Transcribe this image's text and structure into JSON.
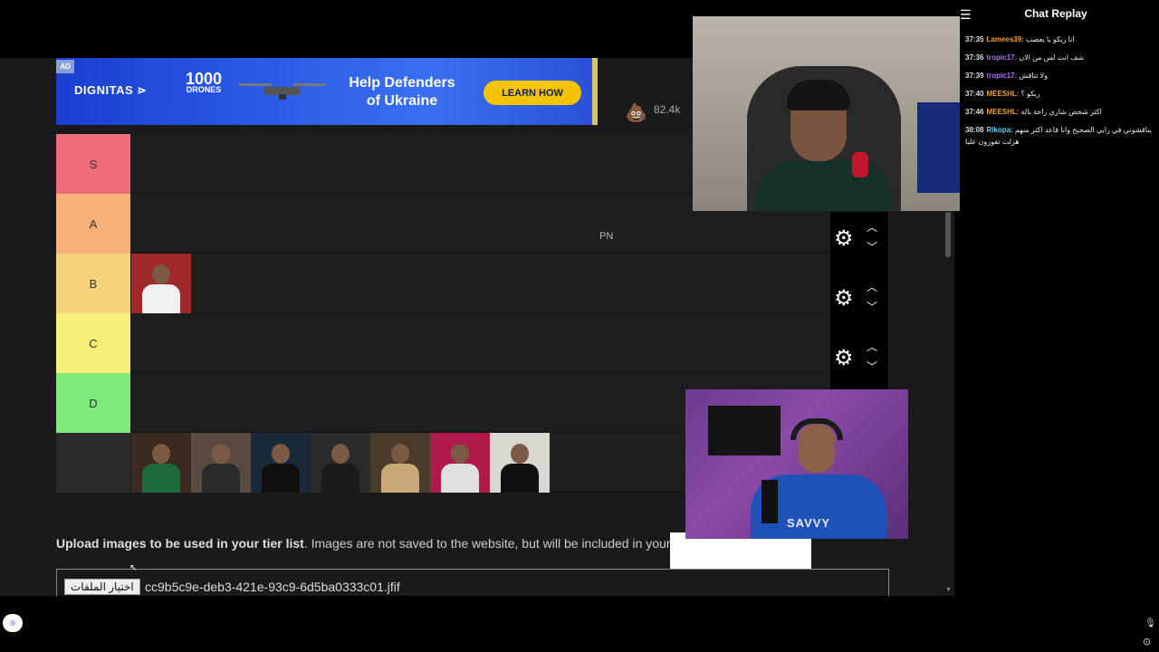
{
  "ad": {
    "tag": "AD",
    "brand": "DIGNITAS",
    "brand_mark": "⋗",
    "drones_number": "1000",
    "drones_word": "DRONES",
    "headline_line1": "Help Defenders",
    "headline_line2": "of Ukraine",
    "cta": "LEARN HOW"
  },
  "reaction": {
    "icon": "poop-icon",
    "count": "82.4k"
  },
  "tiers": [
    {
      "label": "S",
      "color": "#ef6c7a",
      "items": 0
    },
    {
      "label": "A",
      "color": "#f7b07a",
      "items": 0
    },
    {
      "label": "B",
      "color": "#f7d37b",
      "items": 1
    },
    {
      "label": "C",
      "color": "#f5f07a",
      "items": 0
    },
    {
      "label": "D",
      "color": "#7fe97c",
      "items": 0
    },
    {
      "label": "",
      "color": "#2a2a2a",
      "items": 7
    }
  ],
  "overlay_text": "PN",
  "upload": {
    "bold": "Upload images to be used in your tier list",
    "rest": ". Images are not saved to the website, but will be included in your",
    "file_button": "اختيار الملفات",
    "file_name": "cc9b5c9e-deb3-421e-93c9-6d5ba0333c01.jfif"
  },
  "chat": {
    "title": "Chat Replay",
    "messages": [
      {
        "time": "37:35",
        "user": "Lamees39:",
        "color": "#f0a030",
        "text": "انا ريكو يا يعصب"
      },
      {
        "time": "37:36",
        "user": "tropic17:",
        "color": "#b070f0",
        "text": "شف انت لس من الان"
      },
      {
        "time": "37:39",
        "user": "tropic17:",
        "color": "#b070f0",
        "text": "ولا تناقش"
      },
      {
        "time": "37:40",
        "user": "MEESHL:",
        "color": "#f0a030",
        "text": "ريكو ؟"
      },
      {
        "time": "37:46",
        "user": "MEESHL:",
        "color": "#f0a030",
        "text": "اكثر شخص شاري راحة بالة"
      },
      {
        "time": "38:08",
        "user": "Rikopa:",
        "color": "#6cd0ff",
        "text": "يناقشوني في رايي الصحيح وانا قاعد اكثر منهم هزلت تفوزون عليا"
      }
    ]
  },
  "cam2_logo": "SAVVY"
}
